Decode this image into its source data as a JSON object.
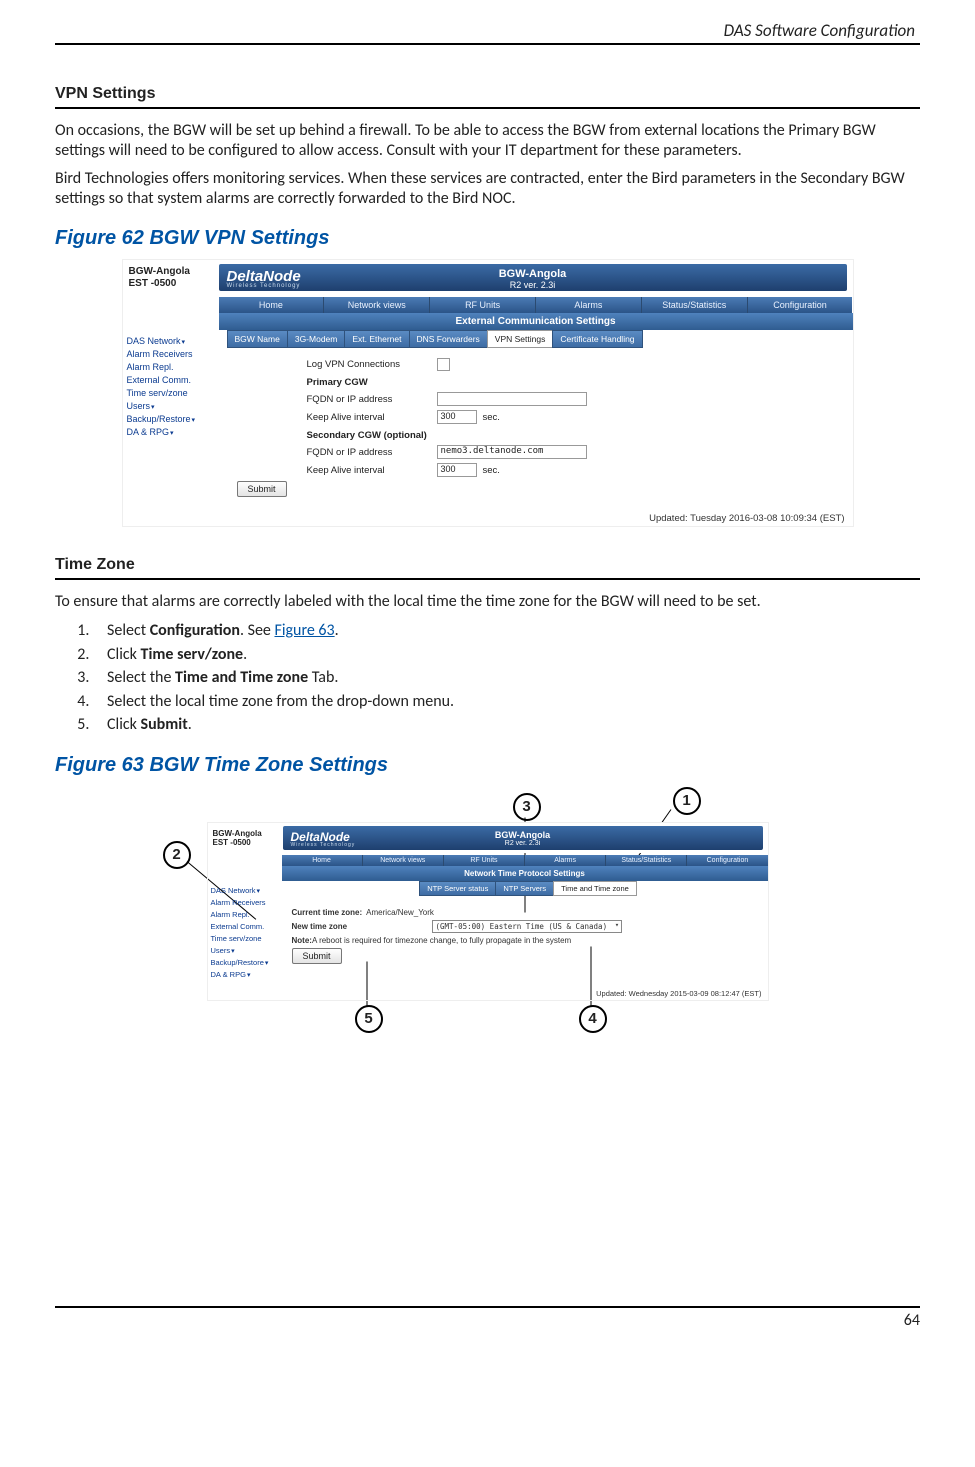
{
  "header": {
    "title": "DAS Software Configuration"
  },
  "page_number": "64",
  "section1": {
    "heading": "VPN Settings",
    "para1": "On occasions, the BGW will be set up behind a firewall. To be able to access the BGW from external locations the Primary BGW settings will need to be configured to allow access. Consult with your IT department for these parameters.",
    "para2": "Bird Technologies offers monitoring services. When these services are contracted, enter the Bird parameters in the Secondary BGW settings so that system alarms are correctly forwarded to the Bird NOC."
  },
  "figure62": {
    "title": "Figure 62    BGW VPN Settings"
  },
  "section2": {
    "heading": "Time Zone",
    "intro": "To ensure that alarms are correctly labeled with the local time the time zone for the BGW will need to be set.",
    "steps": {
      "s1a": "Select ",
      "s1b": "Configuration",
      "s1c": ". See ",
      "s1link": "Figure 63",
      "s1d": ".",
      "s2a": "Click ",
      "s2b": "Time serv/zone",
      "s2c": ".",
      "s3a": "Select the ",
      "s3b": "Time and Time zone",
      "s3c": " Tab.",
      "s4": "Select the local time zone from the drop-down menu.",
      "s5a": "Click ",
      "s5b": "Submit",
      "s5c": "."
    }
  },
  "figure63": {
    "title": "Figure 63    BGW Time Zone Settings"
  },
  "shot_common": {
    "id_line1": "BGW-Angola",
    "id_line2": "EST -0500",
    "logo": "DeltaNode",
    "logo_sub": "Wireless Technology",
    "center1": "BGW-Angola",
    "center2": "R2 ver. 2.3i",
    "nav": {
      "home": "Home",
      "netviews": "Network views",
      "rfunits": "RF Units",
      "alarms": "Alarms",
      "stats": "Status/Statistics",
      "config": "Configuration"
    },
    "side": {
      "das": "DAS Network",
      "alarmrx": "Alarm Receivers",
      "alarmrepl": "Alarm Repl.",
      "extcomm": "External Comm.",
      "timezone": "Time serv/zone",
      "users": "Users",
      "backup": "Backup/Restore",
      "darpg": "DA & RPG"
    }
  },
  "shot1": {
    "ecs_title": "External Communication Settings",
    "subtabs": {
      "bgwname": "BGW Name",
      "modem": "3G-Modem",
      "exteth": "Ext. Ethernet",
      "dns": "DNS Forwarders",
      "vpn": "VPN Settings",
      "cert": "Certificate Handling"
    },
    "form": {
      "logvpn": "Log VPN Connections",
      "primary": "Primary CGW",
      "fqdn": "FQDN or IP address",
      "keepalive": "Keep Alive interval",
      "kav1": "300",
      "sec_unit": "sec.",
      "secondary": "Secondary CGW (optional)",
      "fqdn2_val": "nemo3.deltanode.com",
      "kav2": "300",
      "submit": "Submit"
    },
    "updated": "Updated: Tuesday 2016-03-08 10:09:34 (EST)"
  },
  "shot2": {
    "ntp_title": "Network Time Protocol Settings",
    "subtabs": {
      "status": "NTP Server status",
      "servers": "NTP Servers",
      "tz": "Time and Time zone"
    },
    "form": {
      "current_label": "Current time zone:",
      "current_val": "America/New_York",
      "new_label": "New time zone",
      "select_val": "(GMT-05:00) Eastern Time (US & Canada)",
      "note_label": "Note:",
      "note_text": " A reboot is required for timezone change, to fully propagate in the system",
      "submit": "Submit"
    },
    "updated": "Updated: Wednesday 2015-03-09 08:12:47 (EST)"
  },
  "callouts": {
    "c1": "1",
    "c2": "2",
    "c3": "3",
    "c4": "4",
    "c5": "5"
  }
}
